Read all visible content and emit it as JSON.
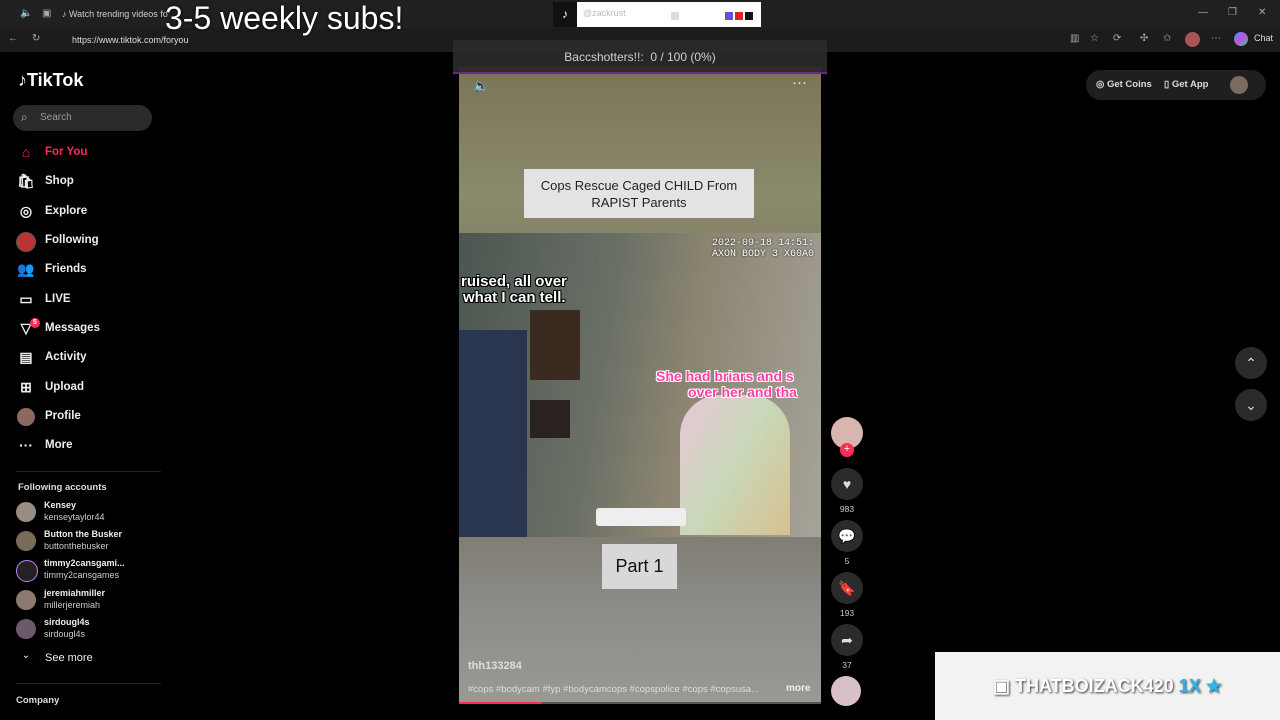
{
  "overlay_title": "3-5 weekly subs!",
  "browser": {
    "tab_title": "Watch trending videos fo",
    "url": "https://www.tiktok.com/foryou",
    "chat_label": "Chat"
  },
  "pinned_widget": {
    "name": "@zackrust",
    "colors": [
      "#6a4fd8",
      "#e02020",
      "#111111"
    ]
  },
  "stream_progress": {
    "label": "Baccshotters!!:",
    "value": "0 / 100 (0%)"
  },
  "sidebar": {
    "logo": "TikTok",
    "search_placeholder": "Search",
    "nav": [
      {
        "label": "For You",
        "icon": "home-icon"
      },
      {
        "label": "Shop",
        "icon": "shop-icon"
      },
      {
        "label": "Explore",
        "icon": "compass-icon"
      },
      {
        "label": "Following",
        "icon": "following-avatar-icon"
      },
      {
        "label": "Friends",
        "icon": "friends-icon"
      },
      {
        "label": "LIVE",
        "icon": "live-icon"
      },
      {
        "label": "Messages",
        "icon": "messages-icon",
        "badge": "5"
      },
      {
        "label": "Activity",
        "icon": "activity-icon"
      },
      {
        "label": "Upload",
        "icon": "upload-icon"
      },
      {
        "label": "Profile",
        "icon": "profile-avatar-icon"
      },
      {
        "label": "More",
        "icon": "more-icon"
      }
    ],
    "following_header": "Following accounts",
    "accounts": [
      {
        "name": "Kensey",
        "handle": "kenseytaylor44"
      },
      {
        "name": "Button the Busker",
        "handle": "buttonthebusker"
      },
      {
        "name": "timmy2cansgami...",
        "handle": "timmy2cansgames"
      },
      {
        "name": "jeremiahmiller",
        "handle": "millerjeremiah"
      },
      {
        "name": "sirdougl4s",
        "handle": "sirdougl4s"
      }
    ],
    "see_more": "See more",
    "company": "Company"
  },
  "video": {
    "caption": "Cops Rescue Caged CHILD From RAPIST Parents",
    "timestamp_line1": "2022-09-18 14:51:",
    "timestamp_line2": "AXON BODY 3 X60A0",
    "subtitle_white_1": "ruised, all over",
    "subtitle_white_2": "what I can tell.",
    "subtitle_pink_1": "She had briars and s",
    "subtitle_pink_2": "over her and tha",
    "part_label": "Part 1",
    "username": "thh133284",
    "hashtags": "#cops #bodycam #fyp #bodycamcops #copspolice #cops #copsusa...",
    "more_label": "more",
    "progress_fraction": 0.23
  },
  "actions": {
    "likes": "983",
    "comments": "5",
    "saves": "193",
    "shares": "37"
  },
  "top_right": {
    "coins": "Get Coins",
    "app": "Get App"
  },
  "streamer_badge": {
    "name": "THATBOIZACK420",
    "multiplier": "1X",
    "star": "★"
  }
}
